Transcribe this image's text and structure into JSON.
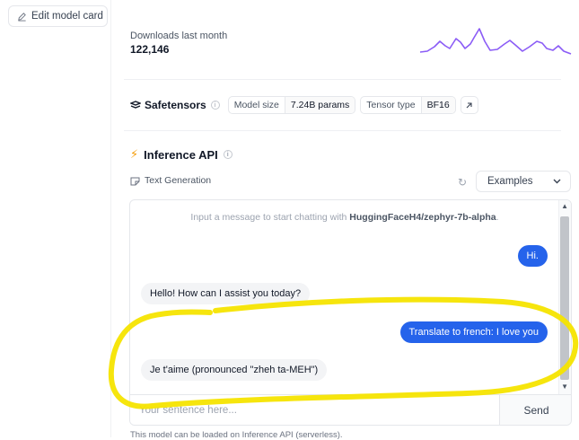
{
  "sidebar": {
    "edit_label": "Edit model card"
  },
  "downloads": {
    "label": "Downloads last month",
    "value": "122,146"
  },
  "safetensors": {
    "title": "Safetensors",
    "model_size_key": "Model size",
    "model_size_value": "7.24B params",
    "tensor_type_key": "Tensor type",
    "tensor_type_value": "BF16"
  },
  "inference": {
    "title": "Inference API",
    "task": "Text Generation",
    "examples_label": "Examples"
  },
  "chat": {
    "hint_prefix": "Input a message to start chatting with ",
    "model_id": "HuggingFaceH4/zephyr-7b-alpha",
    "hint_suffix": ".",
    "messages": [
      {
        "role": "user",
        "text": "Hi."
      },
      {
        "role": "assistant",
        "text": "Hello! How can I assist you today?"
      },
      {
        "role": "user",
        "text": "Translate to french: I love you"
      },
      {
        "role": "assistant",
        "text": "Je t'aime (pronounced \"zheh ta-MEH\")"
      }
    ],
    "input_placeholder": "Your sentence here...",
    "send_label": "Send"
  },
  "footer": {
    "note": "This model can be loaded on Inference API (serverless)."
  },
  "colors": {
    "accent": "#2563eb",
    "sparkline": "#8b5cf6",
    "annotation": "#f5e400",
    "bolt": "#f59e0b"
  }
}
